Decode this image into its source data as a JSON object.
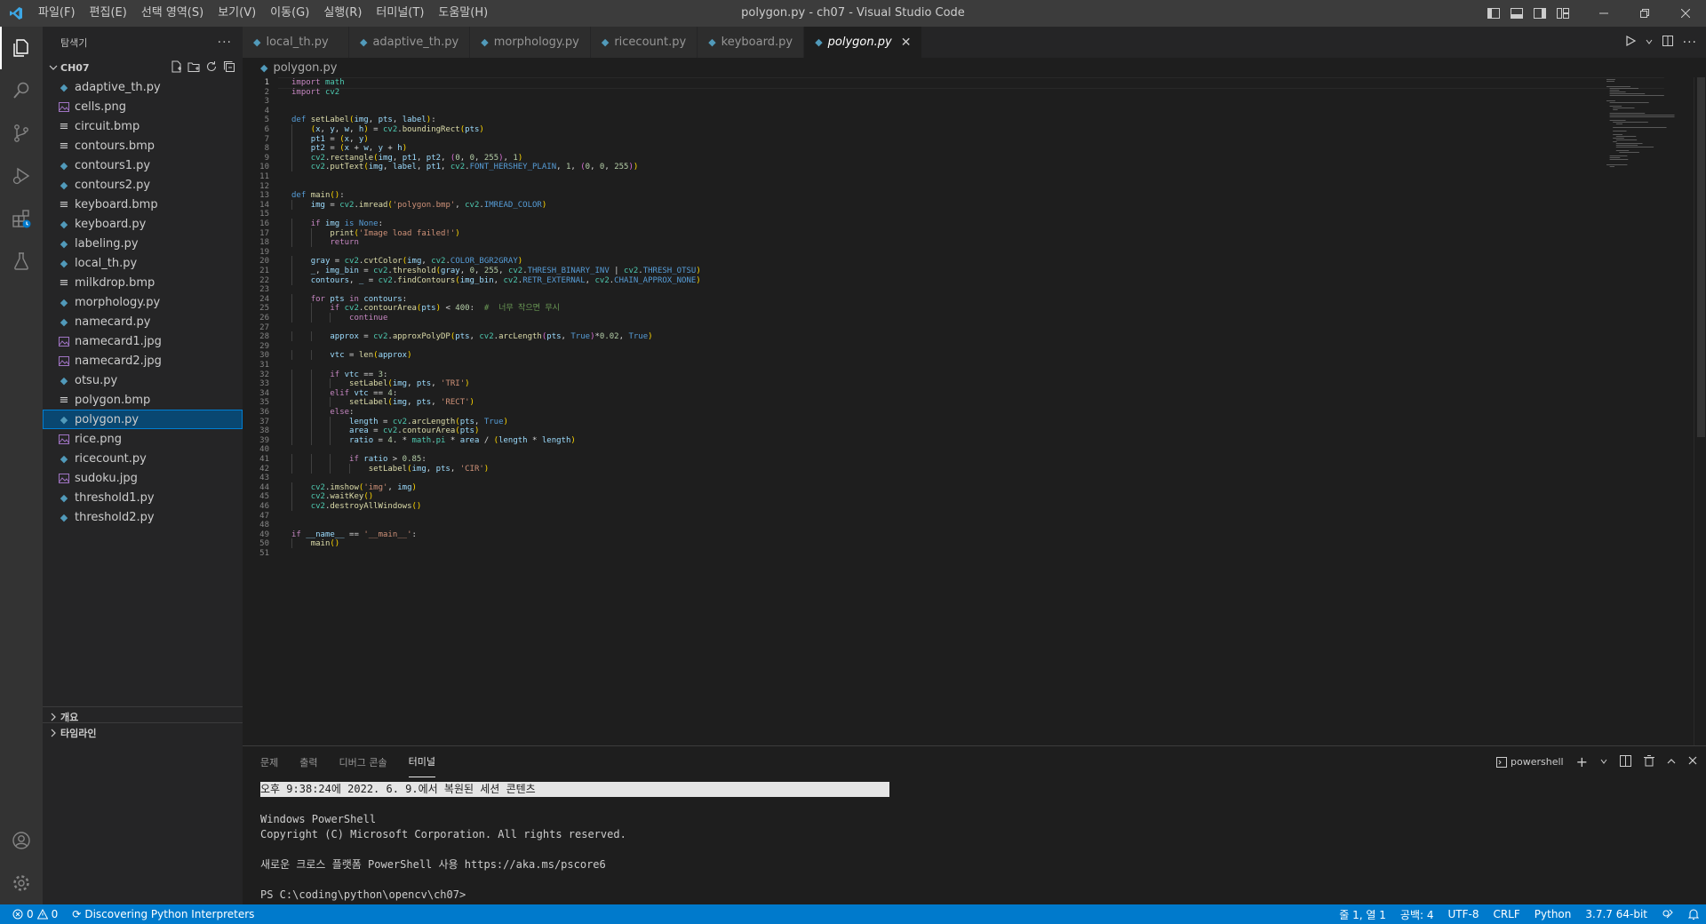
{
  "window": {
    "title": "polygon.py - ch07 - Visual Studio Code"
  },
  "menu": [
    "파일(F)",
    "편집(E)",
    "선택 영역(S)",
    "보기(V)",
    "이동(G)",
    "실행(R)",
    "터미널(T)",
    "도움말(H)"
  ],
  "sidebar": {
    "header": "탐색기",
    "folder": "CH07",
    "files": [
      {
        "name": "adaptive_th.py",
        "type": "py"
      },
      {
        "name": "cells.png",
        "type": "img"
      },
      {
        "name": "circuit.bmp",
        "type": "bmp"
      },
      {
        "name": "contours.bmp",
        "type": "bmp"
      },
      {
        "name": "contours1.py",
        "type": "py"
      },
      {
        "name": "contours2.py",
        "type": "py"
      },
      {
        "name": "keyboard.bmp",
        "type": "bmp"
      },
      {
        "name": "keyboard.py",
        "type": "py"
      },
      {
        "name": "labeling.py",
        "type": "py"
      },
      {
        "name": "local_th.py",
        "type": "py"
      },
      {
        "name": "milkdrop.bmp",
        "type": "bmp"
      },
      {
        "name": "morphology.py",
        "type": "py"
      },
      {
        "name": "namecard.py",
        "type": "py"
      },
      {
        "name": "namecard1.jpg",
        "type": "img"
      },
      {
        "name": "namecard2.jpg",
        "type": "img"
      },
      {
        "name": "otsu.py",
        "type": "py"
      },
      {
        "name": "polygon.bmp",
        "type": "bmp"
      },
      {
        "name": "polygon.py",
        "type": "py",
        "selected": true
      },
      {
        "name": "rice.png",
        "type": "img"
      },
      {
        "name": "ricecount.py",
        "type": "py"
      },
      {
        "name": "sudoku.jpg",
        "type": "img"
      },
      {
        "name": "threshold1.py",
        "type": "py"
      },
      {
        "name": "threshold2.py",
        "type": "py"
      }
    ],
    "sections": [
      "개요",
      "타임라인"
    ]
  },
  "tabs": [
    {
      "label": "local_th.py"
    },
    {
      "label": "adaptive_th.py"
    },
    {
      "label": "morphology.py"
    },
    {
      "label": "ricecount.py"
    },
    {
      "label": "keyboard.py"
    },
    {
      "label": "polygon.py",
      "active": true
    }
  ],
  "breadcrumb": "polygon.py",
  "code": [
    "import math",
    "import cv2",
    "",
    "",
    "def setLabel(img, pts, label):",
    "    (x, y, w, h) = cv2.boundingRect(pts)",
    "    pt1 = (x, y)",
    "    pt2 = (x + w, y + h)",
    "    cv2.rectangle(img, pt1, pt2, (0, 0, 255), 1)",
    "    cv2.putText(img, label, pt1, cv2.FONT_HERSHEY_PLAIN, 1, (0, 0, 255))",
    "",
    "",
    "def main():",
    "    img = cv2.imread('polygon.bmp', cv2.IMREAD_COLOR)",
    "",
    "    if img is None:",
    "        print('Image load failed!')",
    "        return",
    "",
    "    gray = cv2.cvtColor(img, cv2.COLOR_BGR2GRAY)",
    "    _, img_bin = cv2.threshold(gray, 0, 255, cv2.THRESH_BINARY_INV | cv2.THRESH_OTSU)",
    "    contours, _ = cv2.findContours(img_bin, cv2.RETR_EXTERNAL, cv2.CHAIN_APPROX_NONE)",
    "",
    "    for pts in contours:",
    "        if cv2.contourArea(pts) < 400:  #  너무 작으면 무시",
    "            continue",
    "",
    "        approx = cv2.approxPolyDP(pts, cv2.arcLength(pts, True)*0.02, True)",
    "",
    "        vtc = len(approx)",
    "",
    "        if vtc == 3:",
    "            setLabel(img, pts, 'TRI')",
    "        elif vtc == 4:",
    "            setLabel(img, pts, 'RECT')",
    "        else:",
    "            length = cv2.arcLength(pts, True)",
    "            area = cv2.contourArea(pts)",
    "            ratio = 4. * math.pi * area / (length * length)",
    "",
    "            if ratio > 0.85:",
    "                setLabel(img, pts, 'CIR')",
    "",
    "    cv2.imshow('img', img)",
    "    cv2.waitKey()",
    "    cv2.destroyAllWindows()",
    "",
    "",
    "if __name__ == '__main__':",
    "    main()",
    ""
  ],
  "panel": {
    "tabs": [
      "문제",
      "출력",
      "디버그 콘솔",
      "터미널"
    ],
    "active_tab": "터미널",
    "shell": "powershell",
    "terminal_lines": [
      "오후 9:38:24에 2022. 6. 9.에서 복원된 세션 콘텐츠",
      "",
      "Windows PowerShell",
      "Copyright (C) Microsoft Corporation. All rights reserved.",
      "",
      "새로운 크로스 플랫폼 PowerShell 사용 https://aka.ms/pscore6",
      "",
      "PS C:\\coding\\python\\opencv\\ch07>"
    ]
  },
  "statusbar": {
    "errors": "0",
    "warnings": "0",
    "discovering": "Discovering Python Interpreters",
    "position": "줄 1, 열 1",
    "spaces": "공백: 4",
    "encoding": "UTF-8",
    "eol": "CRLF",
    "language": "Python",
    "interpreter": "3.7.7 64-bit"
  },
  "colors": {
    "accent": "#007acc",
    "selection": "#094771",
    "python_icon": "#519aba",
    "image_icon": "#a074c4"
  }
}
